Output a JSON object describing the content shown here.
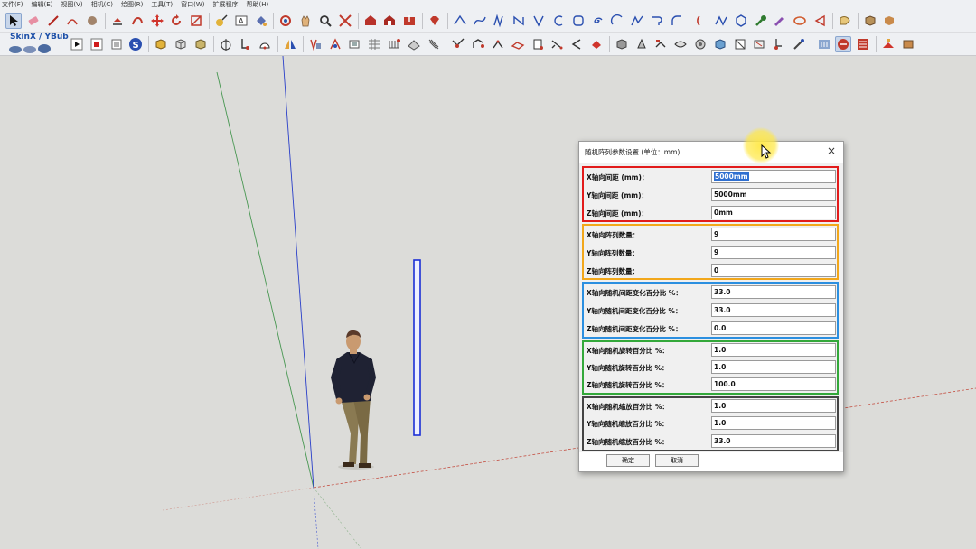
{
  "menubar": {
    "items": [
      "文件(F)",
      "编辑(E)",
      "视图(V)",
      "相机(C)",
      "绘图(R)",
      "工具(T)",
      "窗口(W)",
      "扩展程序",
      "帮助(H)"
    ]
  },
  "toolbar": {
    "skinx_label": "SkinX / YBub"
  },
  "dialog": {
    "title": "随机阵列参数设置 (单位：mm)",
    "close_glyph": "×",
    "rows": [
      {
        "label": "X轴向间距 (mm)：",
        "value": "5000mm"
      },
      {
        "label": "Y轴向间距 (mm)：",
        "value": "5000mm"
      },
      {
        "label": "Z轴向间距 (mm)：",
        "value": "0mm"
      },
      {
        "label": "X轴向阵列数量：",
        "value": "9"
      },
      {
        "label": "Y轴向阵列数量：",
        "value": "9"
      },
      {
        "label": "Z轴向阵列数量：",
        "value": "0"
      },
      {
        "label": "X轴向随机间距变化百分比 %：",
        "value": "33.0"
      },
      {
        "label": "Y轴向随机间距变化百分比 %：",
        "value": "33.0"
      },
      {
        "label": "Z轴向随机间距变化百分比 %：",
        "value": "0.0"
      },
      {
        "label": "X轴向随机旋转百分比 %：",
        "value": "1.0"
      },
      {
        "label": "Y轴向随机旋转百分比 %：",
        "value": "1.0"
      },
      {
        "label": "Z轴向随机旋转百分比 %：",
        "value": "100.0"
      },
      {
        "label": "X轴向随机缩放百分比 %：",
        "value": "1.0"
      },
      {
        "label": "Y轴向随机缩放百分比 %：",
        "value": "1.0"
      },
      {
        "label": "Z轴向随机缩放百分比 %：",
        "value": "33.0"
      }
    ],
    "ok_label": "确定",
    "cancel_label": "取消"
  },
  "colors": {
    "group_red": "#e21b1b",
    "group_orange": "#f2a71b",
    "group_blue": "#2b8fe0",
    "group_green": "#33a83a",
    "group_black": "#444444",
    "selection": "#2f6fd0",
    "axis_red": "#c0392b",
    "axis_green": "#2e8b3a",
    "axis_blue": "#2a3fc9"
  }
}
